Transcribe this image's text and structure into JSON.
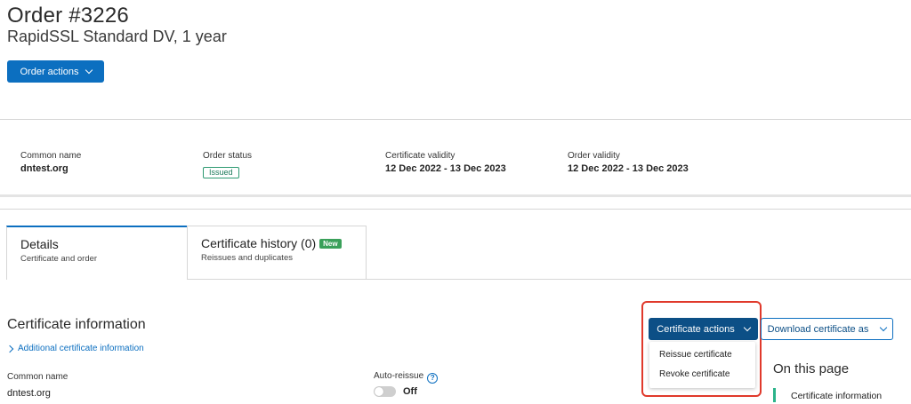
{
  "header": {
    "title": "Order #3226",
    "subtitle": "RapidSSL Standard DV, 1 year",
    "order_actions_label": "Order actions"
  },
  "summary": {
    "common_name_label": "Common name",
    "common_name_value": "dntest.org",
    "order_status_label": "Order status",
    "order_status_value": "Issued",
    "cert_validity_label": "Certificate validity",
    "cert_validity_value": "12 Dec 2022 - 13 Dec 2023",
    "order_validity_label": "Order validity",
    "order_validity_value": "12 Dec 2022 - 13 Dec 2023"
  },
  "tabs": [
    {
      "title": "Details",
      "subtitle": "Certificate and order"
    },
    {
      "title": "Certificate history (0)",
      "subtitle": "Reissues and duplicates",
      "badge": "New"
    }
  ],
  "cert_info": {
    "section_title": "Certificate information",
    "more_link": "Additional certificate information",
    "common_name_label": "Common name",
    "common_name_value": "dntest.org",
    "auto_reissue_label": "Auto-reissue",
    "auto_reissue_value": "Off"
  },
  "actions": {
    "cert_actions_label": "Certificate actions",
    "menu_items": [
      "Reissue certificate",
      "Revoke certificate"
    ],
    "download_label": "Download certificate as"
  },
  "on_this_page": {
    "title": "On this page",
    "items": [
      "Certificate information"
    ]
  },
  "colors": {
    "primary": "#0c6fc0",
    "primary_dark": "#0c4f86",
    "issued_green": "#2e9a72",
    "new_badge": "#3aa05a",
    "highlight_red": "#e0392b"
  }
}
